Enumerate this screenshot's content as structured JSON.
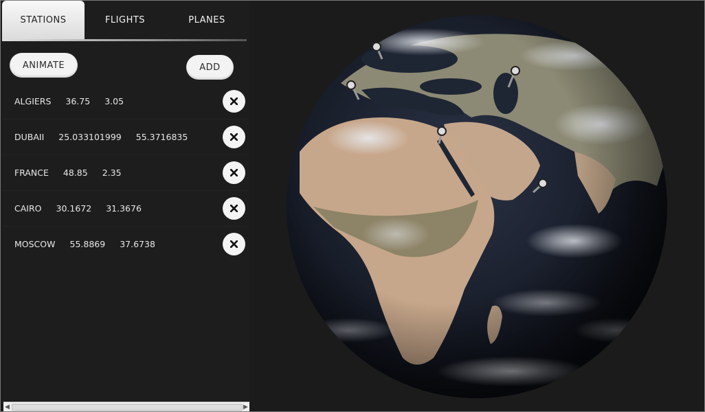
{
  "tabs": [
    {
      "label": "STATIONS",
      "active": true
    },
    {
      "label": "FLIGHTS",
      "active": false
    },
    {
      "label": "PLANES",
      "active": false
    }
  ],
  "buttons": {
    "animate_label": "ANIMATE",
    "add_label": "ADD"
  },
  "stations": [
    {
      "name": "ALGIERS",
      "lat": "36.75",
      "lon": "3.05"
    },
    {
      "name": "DUBAII",
      "lat": "25.033101999",
      "lon": "55.3716835"
    },
    {
      "name": "FRANCE",
      "lat": "48.85",
      "lon": "2.35"
    },
    {
      "name": "CAIRO",
      "lat": "30.1672",
      "lon": "31.3676"
    },
    {
      "name": "MOSCOW",
      "lat": "55.8869",
      "lon": "37.6738"
    }
  ],
  "icons": {
    "delete": "close-icon",
    "marker": "map-pin-icon"
  },
  "colors": {
    "background": "#1c1c1c",
    "button": "#f3f3f3",
    "text": "#e8e8e8"
  }
}
